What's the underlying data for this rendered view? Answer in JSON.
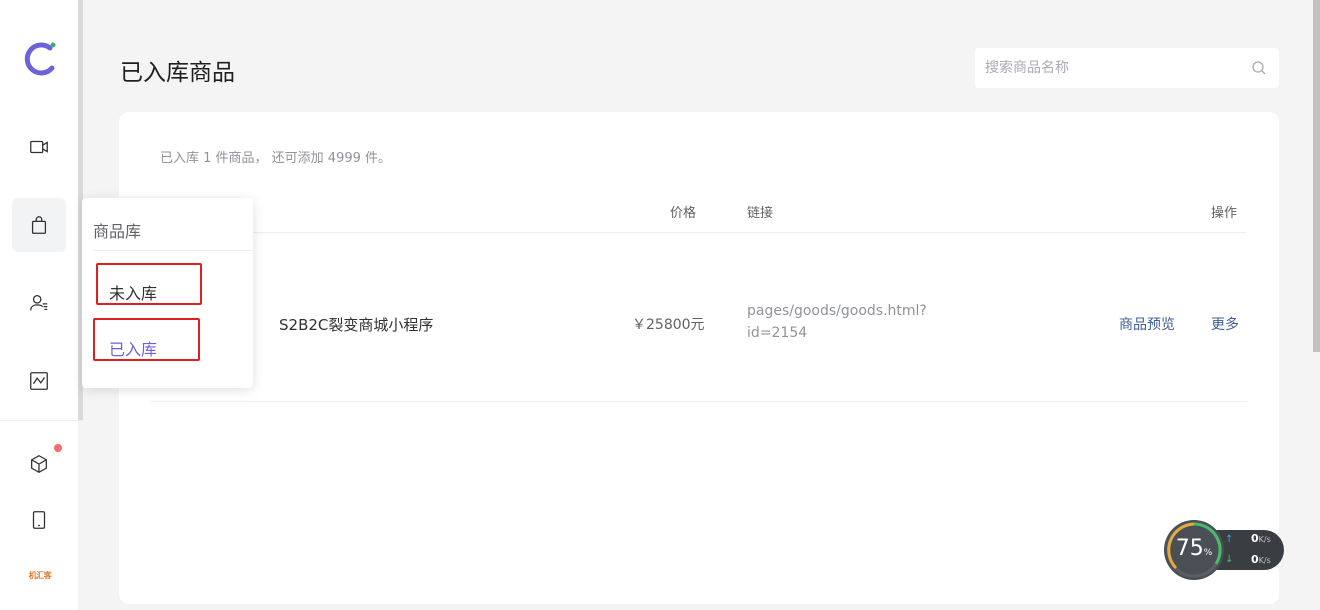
{
  "page": {
    "title": "已入库商品"
  },
  "search": {
    "placeholder": "搜索商品名称"
  },
  "summary": "已入库 1 件商品， 还可添加 4999 件。",
  "table": {
    "headers": {
      "price": "价格",
      "link": "链接",
      "actions": "操作"
    },
    "rows": [
      {
        "name": "S2B2C裂变商城小程序",
        "price": "￥25800元",
        "link": "pages/goods/goods.html?id=2154",
        "action_preview": "商品预览",
        "action_more": "更多"
      }
    ]
  },
  "popover": {
    "title": "商品库",
    "items": [
      {
        "label": "未入库"
      },
      {
        "label": "已入库"
      }
    ]
  },
  "sidebar": {
    "icons": [
      "video-icon",
      "shopping-bag-icon",
      "user-list-icon",
      "chart-icon",
      "cube-icon",
      "tablet-icon"
    ],
    "brand": "机汇客"
  },
  "speed_widget": {
    "percent": "75",
    "percent_unit": "%",
    "up_value": "0",
    "down_value": "0",
    "unit": "K/s"
  },
  "colors": {
    "accent": "#6c63d9",
    "link_action": "#3e5c9a",
    "highlight": "#e02020",
    "notify_dot": "#f56c6c"
  }
}
